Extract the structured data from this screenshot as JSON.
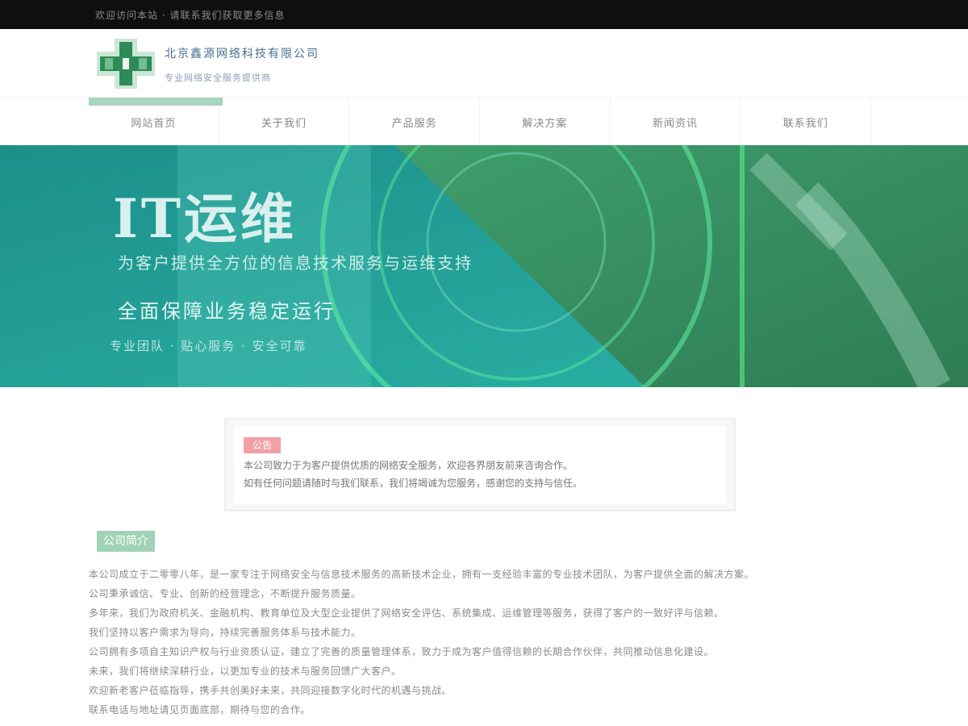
{
  "topbar": {
    "text": "欢迎访问本站 · 请联系我们获取更多信息"
  },
  "header": {
    "logo_name": "北京鑫源网络科技有限公司",
    "logo_sub": "专业网络安全服务提供商"
  },
  "nav": {
    "items": [
      {
        "label": "网站首页"
      },
      {
        "label": "关于我们"
      },
      {
        "label": "产品服务"
      },
      {
        "label": "解决方案"
      },
      {
        "label": "新闻资讯"
      },
      {
        "label": "联系我们"
      }
    ]
  },
  "banner": {
    "headline": "IT运维",
    "line1": "为客户提供全方位的信息技术服务与运维支持",
    "line2": "全面保障业务稳定运行",
    "line3": "专业团队 · 贴心服务 · 安全可靠"
  },
  "notice": {
    "badge": "公告",
    "row1": "本公司致力于为客户提供优质的网络安全服务，欢迎各界朋友前来咨询合作。",
    "row2": "如有任何问题请随时与我们联系，我们将竭诚为您服务，感谢您的支持与信任。"
  },
  "section": {
    "title": "公司简介",
    "paragraphs": [
      "本公司成立于二零零八年，是一家专注于网络安全与信息技术服务的高新技术企业，拥有一支经验丰富的专业技术团队，为客户提供全面的解决方案。",
      "公司秉承诚信、专业、创新的经营理念，不断提升服务质量。",
      "多年来，我们为政府机关、金融机构、教育单位及大型企业提供了网络安全评估、系统集成、运维管理等服务，获得了客户的一致好评与信赖。",
      "我们坚持以客户需求为导向，持续完善服务体系与技术能力。",
      "公司拥有多项自主知识产权与行业资质认证，建立了完善的质量管理体系，致力于成为客户值得信赖的长期合作伙伴，共同推动信息化建设。",
      "未来，我们将继续深耕行业，以更加专业的技术与服务回馈广大客户。",
      "欢迎新老客户莅临指导，携手共创美好未来，共同迎接数字化时代的机遇与挑战。",
      "联系电话与地址请见页面底部，期待与您的合作。"
    ]
  },
  "colors": {
    "primary_green": "#2e8b57",
    "light_green": "#9fd2b6",
    "teal": "#1fa39a",
    "badge_red": "#f2a0a6"
  }
}
